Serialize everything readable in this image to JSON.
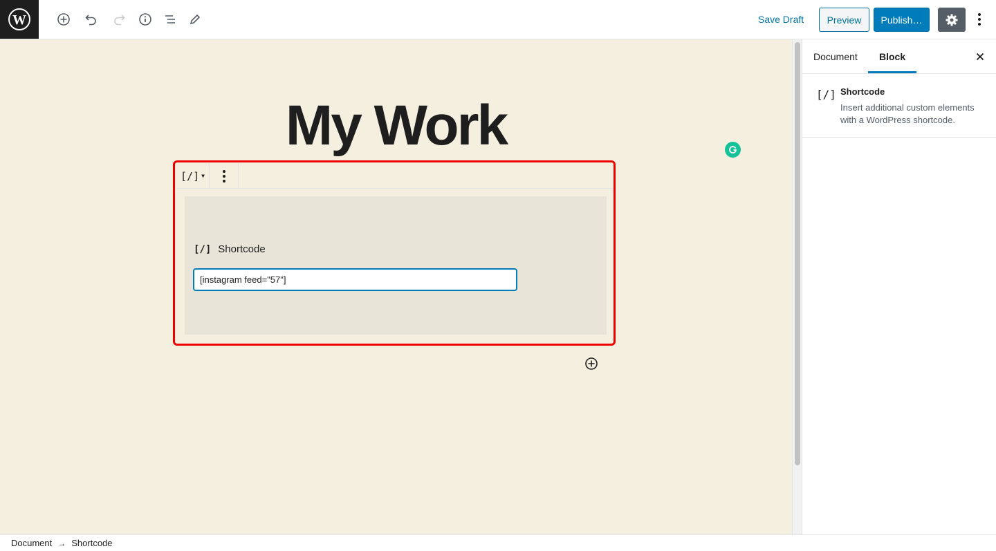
{
  "header": {
    "save_draft": "Save Draft",
    "preview": "Preview",
    "publish": "Publish…"
  },
  "editor": {
    "title": "My Work",
    "block": {
      "switcher_glyph": "[/]",
      "label_glyph": "[/]",
      "label": "Shortcode",
      "input_value": "[instagram feed=\"57\"]"
    }
  },
  "sidebar": {
    "tabs": [
      {
        "label": "Document",
        "active": false
      },
      {
        "label": "Block",
        "active": true
      }
    ],
    "block_card": {
      "icon": "[/]",
      "title": "Shortcode",
      "description": "Insert additional custom elements with a WordPress shortcode."
    }
  },
  "footer": {
    "breadcrumb": [
      "Document",
      "Shortcode"
    ]
  },
  "colors": {
    "accent": "#007cba",
    "canvas_bg": "#f5efe0",
    "highlight_border": "#e00000",
    "grammarly": "#15c39a"
  }
}
